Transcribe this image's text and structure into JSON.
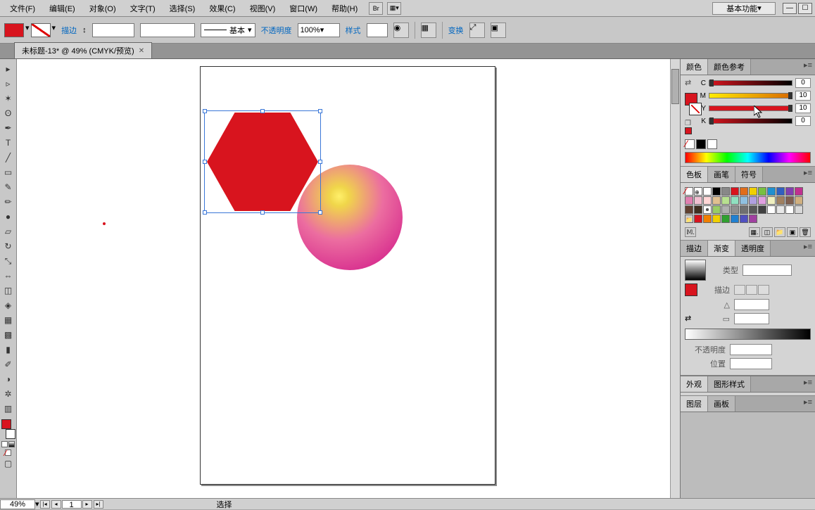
{
  "menubar": {
    "items": [
      "文件(F)",
      "编辑(E)",
      "对象(O)",
      "文字(T)",
      "选择(S)",
      "效果(C)",
      "视图(V)",
      "窗口(W)",
      "帮助(H)"
    ],
    "workspace_label": "基本功能"
  },
  "control": {
    "stroke_label": "描边",
    "basic_label": "基本",
    "opacity_label": "不透明度",
    "opacity_value": "100%",
    "style_label": "样式",
    "transform_label": "变换"
  },
  "doc_tab": {
    "title": "未标题-13* @ 49% (CMYK/预览)"
  },
  "status": {
    "zoom": "49%",
    "page": "1",
    "tool": "选择"
  },
  "panels": {
    "color_tabs": [
      "颜色",
      "颜色参考"
    ],
    "color_channels": [
      {
        "ch": "C",
        "val": "0"
      },
      {
        "ch": "M",
        "val": "10"
      },
      {
        "ch": "Y",
        "val": "10"
      },
      {
        "ch": "K",
        "val": "0"
      }
    ],
    "swatch_tabs": [
      "色板",
      "画笔",
      "符号"
    ],
    "swatch_colors_row1": [
      "#ffffff",
      "#000000",
      "#888888",
      "#d8141e",
      "#e06d1a",
      "#f0d000",
      "#78c040",
      "#2090d0",
      "#3060c0",
      "#8040b0",
      "#c03090",
      "#e080b0",
      "#f0c0d0"
    ],
    "swatch_colors_row2": [
      "#ffd6d6",
      "#e0c090",
      "#b8e090",
      "#90e0c0",
      "#90c0e0",
      "#b0a0e0",
      "#e0a0e0",
      "#f0f0c0",
      "#a08060",
      "#806050",
      "#d0b080",
      "#604030",
      "#403020"
    ],
    "swatch_colors_row3": [
      "#b0b0b0",
      "#909090",
      "#707070",
      "#585858",
      "#404040",
      "#ffffff",
      "#e8e8e8",
      "#ffffff",
      "#d8d8d8"
    ],
    "swatch_colors_row4": [
      "#d8141e",
      "#f08000",
      "#f0d000",
      "#30a030",
      "#2080d0",
      "#5050c0",
      "#a040a0"
    ],
    "stroke_grad_tabs": [
      "描边",
      "渐变",
      "透明度"
    ],
    "grad": {
      "type_label": "类型",
      "stroke_label": "描边",
      "angle_label": "△",
      "aspect_label": "▭",
      "opacity_label": "不透明度",
      "position_label": "位置"
    },
    "bottom_tabs": [
      "外观",
      "图形样式"
    ],
    "layer_tabs": [
      "图层",
      "画板"
    ]
  }
}
